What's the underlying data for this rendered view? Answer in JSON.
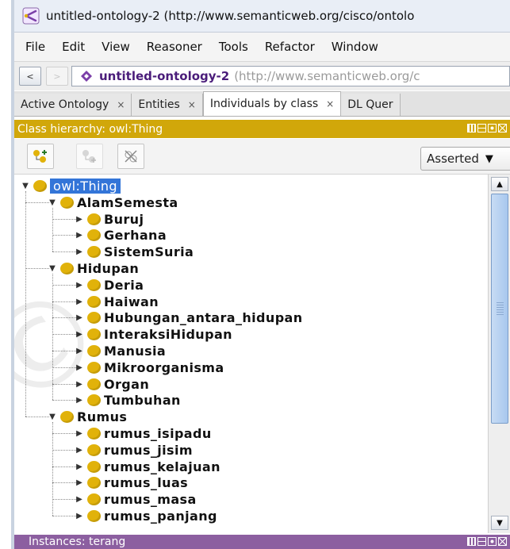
{
  "window": {
    "title": "untitled-ontology-2 (http://www.semanticweb.org/cisco/ontolo"
  },
  "menu": [
    "File",
    "Edit",
    "View",
    "Reasoner",
    "Tools",
    "Refactor",
    "Window"
  ],
  "address": {
    "back_label": "<",
    "forward_label": ">",
    "ontology_name": "untitled-ontology-2",
    "ontology_uri": "(http://www.semanticweb.org/c"
  },
  "tabs": [
    {
      "label": "Active Ontology",
      "close": "×"
    },
    {
      "label": "Entities",
      "close": "×"
    },
    {
      "label": "Individuals by class",
      "close": "×"
    },
    {
      "label": "DL Quer",
      "close": ""
    }
  ],
  "class_view": {
    "title": "Class hierarchy: owl:Thing",
    "dropdown_value": "Asserted",
    "dropdown_arrow": "▼"
  },
  "tree": [
    {
      "label": "owl:Thing",
      "depth": 0,
      "expanded": true,
      "selected": true
    },
    {
      "label": "AlamSemesta",
      "depth": 1,
      "expanded": true
    },
    {
      "label": "Buruj",
      "depth": 2,
      "expanded": false
    },
    {
      "label": "Gerhana",
      "depth": 2,
      "expanded": false
    },
    {
      "label": "SistemSuria",
      "depth": 2,
      "expanded": false
    },
    {
      "label": "Hidupan",
      "depth": 1,
      "expanded": true
    },
    {
      "label": "Deria",
      "depth": 2,
      "expanded": false
    },
    {
      "label": "Haiwan",
      "depth": 2,
      "expanded": false
    },
    {
      "label": "Hubungan_antara_hidupan",
      "depth": 2,
      "expanded": false
    },
    {
      "label": "InteraksiHidupan",
      "depth": 2,
      "expanded": false
    },
    {
      "label": "Manusia",
      "depth": 2,
      "expanded": false
    },
    {
      "label": "Mikroorganisma",
      "depth": 2,
      "expanded": false
    },
    {
      "label": "Organ",
      "depth": 2,
      "expanded": false
    },
    {
      "label": "Tumbuhan",
      "depth": 2,
      "expanded": false
    },
    {
      "label": "Rumus",
      "depth": 1,
      "expanded": true
    },
    {
      "label": "rumus_isipadu",
      "depth": 2,
      "expanded": false
    },
    {
      "label": "rumus_jisim",
      "depth": 2,
      "expanded": false
    },
    {
      "label": "rumus_kelajuan",
      "depth": 2,
      "expanded": false
    },
    {
      "label": "rumus_luas",
      "depth": 2,
      "expanded": false
    },
    {
      "label": "rumus_masa",
      "depth": 2,
      "expanded": false
    },
    {
      "label": "rumus_panjang",
      "depth": 2,
      "expanded": false
    }
  ],
  "instances_view": {
    "title": "Instances: terang"
  },
  "watermark": "Copyright@F",
  "colors": {
    "class_header": "#d1a70a",
    "instances_header": "#8c5fa0",
    "class_dot": "#e1b20a",
    "selection": "#3375d8",
    "ontology_diamond": "#7b3fa8"
  }
}
